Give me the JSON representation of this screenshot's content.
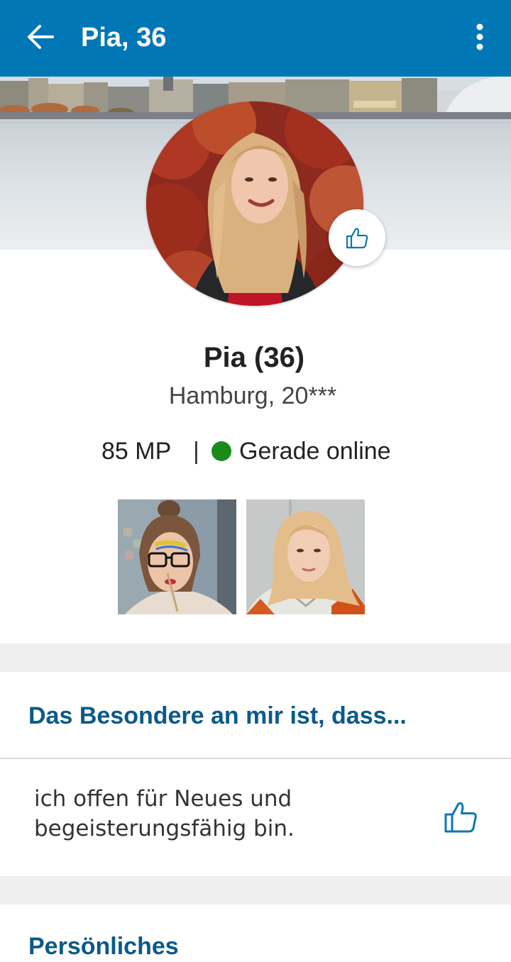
{
  "appbar": {
    "title": "Pia, 36",
    "back_icon": "arrow-left-icon",
    "menu_icon": "more-vertical-icon",
    "background_color": "#0277b6"
  },
  "profile": {
    "name": "Pia (36)",
    "location": "Hamburg, 20***",
    "points": "85 MP",
    "separator": "|",
    "status": "Gerade online",
    "status_color": "#1a8a1a",
    "like_icon": "thumbs-up-icon"
  },
  "gallery": {
    "photos": [
      "photo-1",
      "photo-2"
    ]
  },
  "sections": [
    {
      "title": "Das Besondere an mir ist, dass...",
      "answer_line1": "ich offen für Neues und",
      "answer_line2": "begeisterungsfähig bin.",
      "like_icon": "thumbs-up-icon"
    },
    {
      "title": "Persönliches"
    }
  ],
  "colors": {
    "accent": "#0a5a8a",
    "section_gap": "#efefef"
  }
}
